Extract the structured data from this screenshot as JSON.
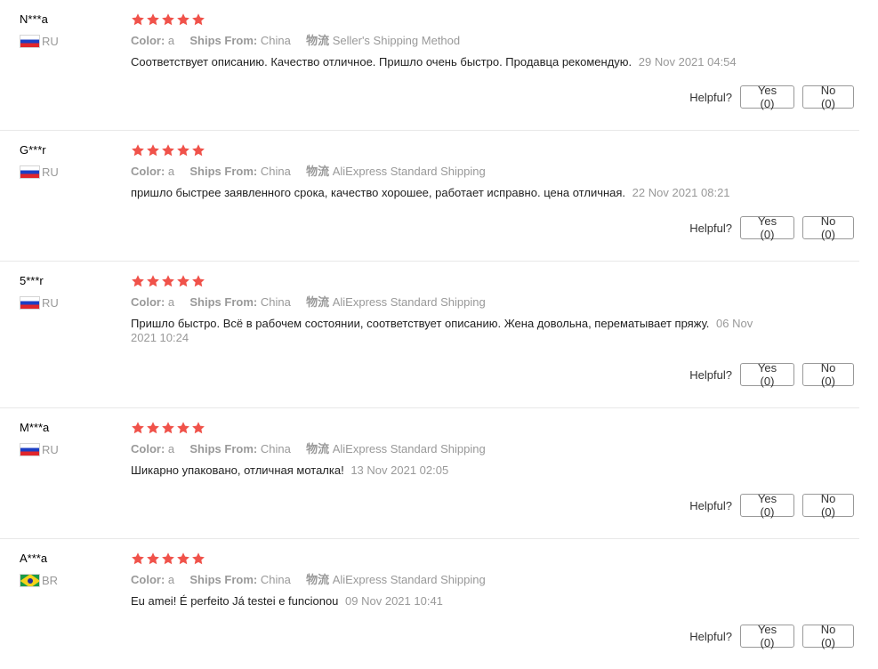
{
  "labels": {
    "color_key": "Color:",
    "ships_key": "Ships From:",
    "logistics_key": "物流",
    "helpful": "Helpful?"
  },
  "colors": {
    "star": "#f0524a",
    "muted": "#999999"
  },
  "reviews": [
    {
      "user": "N***a",
      "country": "RU",
      "flag": "ru",
      "rating": 5,
      "color": "a",
      "ships_from": "China",
      "shipping": "Seller's Shipping Method",
      "text": "Соответствует описанию. Качество отличное. Пришло очень быстро. Продавца рекомендую.",
      "date": "29 Nov 2021 04:54",
      "yes": "Yes (0)",
      "no": "No (0)"
    },
    {
      "user": "G***r",
      "country": "RU",
      "flag": "ru",
      "rating": 5,
      "color": "a",
      "ships_from": "China",
      "shipping": "AliExpress Standard Shipping",
      "text": "пришло быстрее заявленного срока, качество хорошее, работает исправно. цена отличная.",
      "date": "22 Nov 2021 08:21",
      "yes": "Yes (0)",
      "no": "No (0)"
    },
    {
      "user": "5***r",
      "country": "RU",
      "flag": "ru",
      "rating": 5,
      "color": "a",
      "ships_from": "China",
      "shipping": "AliExpress Standard Shipping",
      "text": "Пришло быстро. Всё в рабочем состоянии, соответствует описанию. Жена довольна, перематывает пряжу.",
      "date": "06 Nov 2021 10:24",
      "yes": "Yes (0)",
      "no": "No (0)"
    },
    {
      "user": "M***a",
      "country": "RU",
      "flag": "ru",
      "rating": 5,
      "color": "a",
      "ships_from": "China",
      "shipping": "AliExpress Standard Shipping",
      "text": "Шикарно упаковано, отличная моталка!",
      "date": "13 Nov 2021 02:05",
      "yes": "Yes (0)",
      "no": "No (0)"
    },
    {
      "user": "A***a",
      "country": "BR",
      "flag": "br",
      "rating": 5,
      "color": "a",
      "ships_from": "China",
      "shipping": "AliExpress Standard Shipping",
      "text": "Eu amei! É perfeito Já testei e funcionou",
      "date": "09 Nov 2021 10:41",
      "yes": "Yes (0)",
      "no": "No (0)"
    }
  ]
}
